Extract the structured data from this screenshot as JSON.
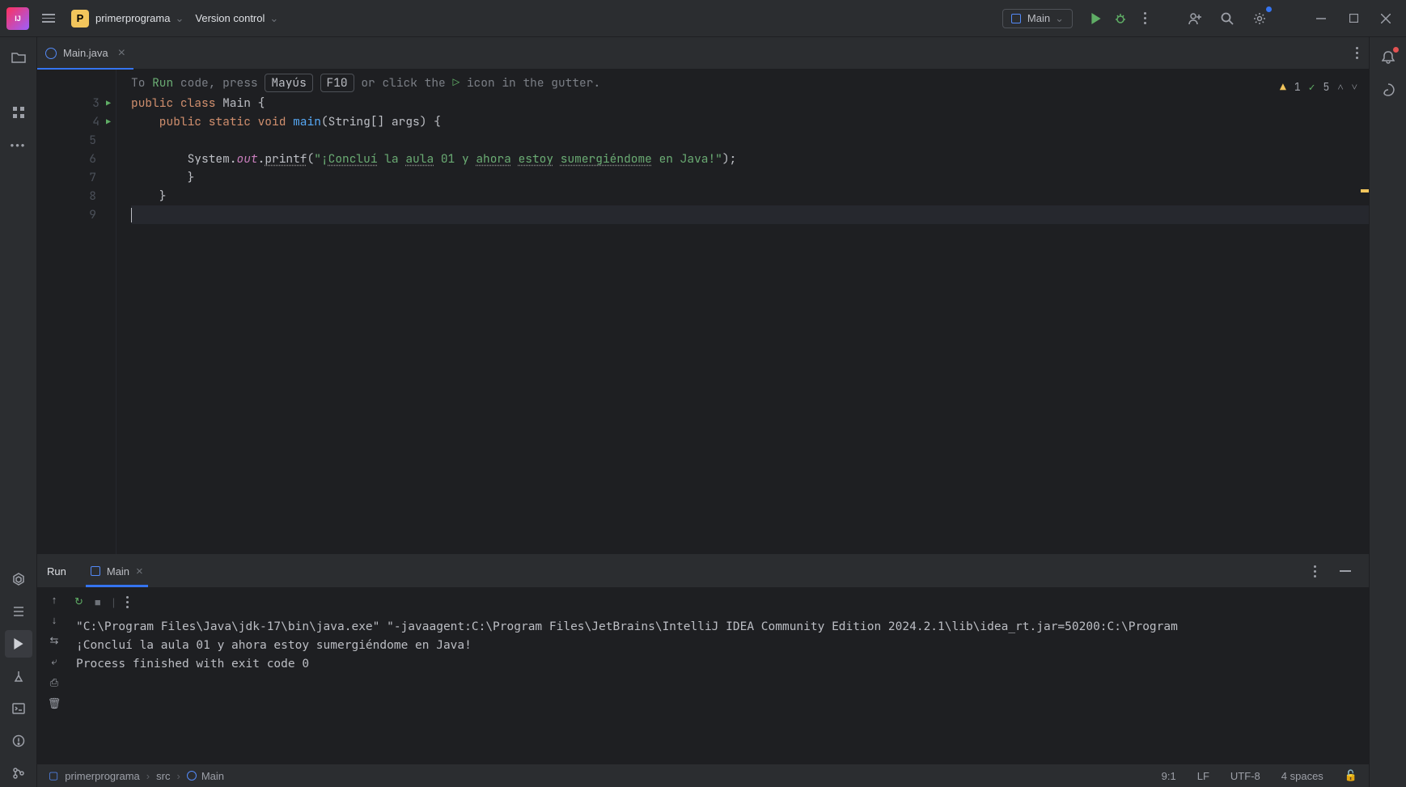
{
  "titlebar": {
    "project_badge": "P",
    "project_name": "primerprograma",
    "version_control": "Version control",
    "run_config": "Main"
  },
  "tab": {
    "filename": "Main.java"
  },
  "hint": {
    "pre": "To ",
    "run": "Run",
    "mid": " code, press ",
    "k1": "Mayús",
    "k2": "F10",
    "post": " or click the ",
    "post2": " icon in the gutter."
  },
  "gutter": {
    "l3": "3",
    "l4": "4",
    "l5": "5",
    "l6": "6",
    "l7": "7",
    "l8": "8",
    "l9": "9"
  },
  "code": {
    "l3a": "public",
    "l3b": " class ",
    "l3c": "Main",
    "l3d": " {",
    "l4a": "    public",
    "l4b": " static ",
    "l4c": "void ",
    "l4d": "main",
    "l4e": "(String[] args) {",
    "l6a": "        System.",
    "l6b": "out",
    "l6c": ".",
    "l6d": "printf",
    "l6e": "(",
    "l6f": "\"¡",
    "l6g": "Concluí",
    "l6h": " la ",
    "l6i": "aula",
    "l6j": " 01 y ",
    "l6k": "ahora",
    "l6l": " ",
    "l6m": "estoy",
    "l6n": " ",
    "l6o": "sumergiéndome",
    "l6p": " en Java!\"",
    "l6q": ");",
    "l7": "        }",
    "l8": "    }"
  },
  "inspection": {
    "warn_count": "1",
    "check_count": "5"
  },
  "run": {
    "title": "Run",
    "tab": "Main",
    "out1": "\"C:\\Program Files\\Java\\jdk-17\\bin\\java.exe\" \"-javaagent:C:\\Program Files\\JetBrains\\IntelliJ IDEA Community Edition 2024.2.1\\lib\\idea_rt.jar=50200:C:\\Program",
    "out2": "¡Concluí la aula 01 y ahora estoy sumergiéndome en Java!",
    "out3": "Process finished with exit code 0"
  },
  "breadcrumb": {
    "p1": "primerprograma",
    "p2": "src",
    "p3": "Main"
  },
  "status": {
    "pos": "9:1",
    "le": "LF",
    "enc": "UTF-8",
    "indent": "4 spaces"
  }
}
